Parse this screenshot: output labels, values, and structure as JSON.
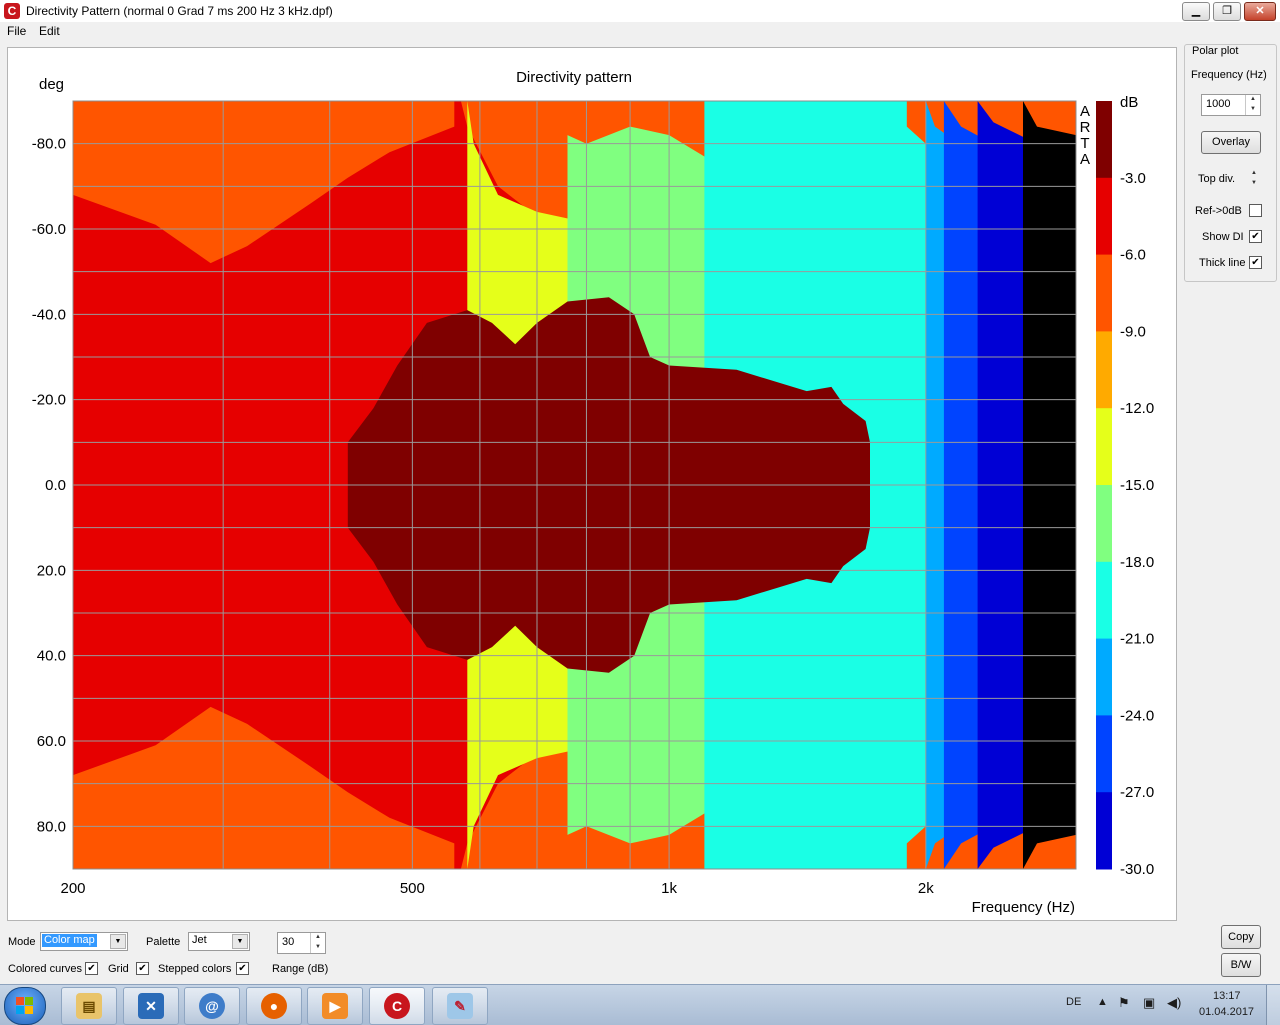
{
  "window": {
    "title": "Directivity Pattern  (normal 0 Grad 7 ms 200 Hz 3 kHz.dpf)",
    "app_icon_glyph": "C",
    "minimize_glyph": "▁",
    "restore_glyph": "❐",
    "close_glyph": "✕"
  },
  "menu": {
    "file": "File",
    "edit": "Edit"
  },
  "chart_data": {
    "type": "heatmap",
    "title": "Directivity pattern",
    "ylabel": "deg",
    "xlabel": "Frequency (Hz)",
    "x_scale": "log",
    "xlim": [
      200,
      3000
    ],
    "ylim": [
      -90,
      90
    ],
    "x_tick_labels": [
      {
        "value": 200,
        "label": "200"
      },
      {
        "value": 500,
        "label": "500"
      },
      {
        "value": 1000,
        "label": "1k"
      },
      {
        "value": 2000,
        "label": "2k"
      }
    ],
    "x_gridlines": [
      200,
      300,
      400,
      500,
      600,
      700,
      800,
      900,
      1000,
      2000,
      3000
    ],
    "y_ticks": [
      -80,
      -60,
      -40,
      -20,
      0,
      20,
      40,
      60,
      80
    ],
    "y_tick_labels": [
      "-80.0",
      "-60.0",
      "-40.0",
      "-20.0",
      "0.0",
      "20.0",
      "40.0",
      "60.0",
      "80.0"
    ],
    "y_gridlines": [
      -90,
      -80,
      -70,
      -60,
      -50,
      -40,
      -30,
      -20,
      -10,
      0,
      10,
      20,
      30,
      40,
      50,
      60,
      70,
      80,
      90
    ],
    "grid": true,
    "watermark": [
      "A",
      "R",
      "T",
      "A"
    ],
    "colorbar": {
      "unit": "dB",
      "tick_labels": [
        "-3.0",
        "-6.0",
        "-9.0",
        "-12.0",
        "-15.0",
        "-18.0",
        "-21.0",
        "-24.0",
        "-27.0",
        "-30.0"
      ],
      "levels": [
        {
          "max": 0,
          "min": -3,
          "color": "#7f0000"
        },
        {
          "max": -3,
          "min": -6,
          "color": "#e60000"
        },
        {
          "max": -6,
          "min": -9,
          "color": "#ff5500"
        },
        {
          "max": -9,
          "min": -12,
          "color": "#ffaa00"
        },
        {
          "max": -12,
          "min": -15,
          "color": "#e5ff1a"
        },
        {
          "max": -15,
          "min": -18,
          "color": "#80ff80"
        },
        {
          "max": -18,
          "min": -21,
          "color": "#1affe5"
        },
        {
          "max": -21,
          "min": -24,
          "color": "#00aaff"
        },
        {
          "max": -24,
          "min": -27,
          "color": "#0044ff"
        },
        {
          "max": -27,
          "min": -30,
          "color": "#0000d5"
        }
      ]
    },
    "contours": [
      {
        "level": -6,
        "points": [
          [
            200,
            -90
          ],
          [
            200,
            -68
          ],
          [
            250,
            -61
          ],
          [
            290,
            -52
          ],
          [
            320,
            -56
          ],
          [
            380,
            -66
          ],
          [
            420,
            -72
          ],
          [
            470,
            -78
          ],
          [
            560,
            -84
          ],
          [
            560,
            -90
          ],
          [
            570,
            -90
          ],
          [
            580,
            -84
          ],
          [
            630,
            -70
          ],
          [
            720,
            -61
          ],
          [
            800,
            -60
          ],
          [
            900,
            -64
          ],
          [
            960,
            -60
          ],
          [
            1050,
            -52
          ],
          [
            1200,
            -47
          ],
          [
            1400,
            -44
          ],
          [
            1600,
            -44
          ],
          [
            1900,
            -36
          ],
          [
            2200,
            -26
          ],
          [
            2400,
            -18
          ],
          [
            2500,
            -8
          ],
          [
            2500,
            8
          ],
          [
            2400,
            18
          ],
          [
            2200,
            26
          ],
          [
            1900,
            36
          ],
          [
            1600,
            44
          ],
          [
            1400,
            44
          ],
          [
            1200,
            47
          ],
          [
            1050,
            52
          ],
          [
            960,
            60
          ],
          [
            900,
            64
          ],
          [
            800,
            60
          ],
          [
            720,
            61
          ],
          [
            630,
            70
          ],
          [
            580,
            84
          ],
          [
            570,
            90
          ],
          [
            560,
            90
          ],
          [
            560,
            84
          ],
          [
            470,
            78
          ],
          [
            420,
            72
          ],
          [
            380,
            66
          ],
          [
            320,
            56
          ],
          [
            290,
            52
          ],
          [
            250,
            61
          ],
          [
            200,
            68
          ],
          [
            200,
            90
          ]
        ]
      },
      {
        "level": -9,
        "points": [
          [
            580,
            -90
          ],
          [
            590,
            -80
          ],
          [
            630,
            -68
          ],
          [
            700,
            -64
          ],
          [
            780,
            -62
          ],
          [
            860,
            -60
          ],
          [
            920,
            -70
          ],
          [
            1000,
            -70
          ],
          [
            1100,
            -64
          ],
          [
            1300,
            -63
          ],
          [
            1500,
            -62
          ],
          [
            1800,
            -58
          ],
          [
            2050,
            -50
          ],
          [
            2400,
            -40
          ],
          [
            2700,
            -34
          ],
          [
            3000,
            -26
          ],
          [
            3000,
            26
          ],
          [
            2700,
            34
          ],
          [
            2400,
            40
          ],
          [
            2050,
            50
          ],
          [
            1800,
            58
          ],
          [
            1500,
            62
          ],
          [
            1300,
            63
          ],
          [
            1100,
            64
          ],
          [
            1000,
            70
          ],
          [
            920,
            70
          ],
          [
            860,
            60
          ],
          [
            780,
            62
          ],
          [
            700,
            64
          ],
          [
            630,
            68
          ],
          [
            590,
            80
          ],
          [
            580,
            90
          ]
        ]
      },
      {
        "level": -12,
        "points": [
          [
            760,
            -90
          ],
          [
            760,
            -82
          ],
          [
            800,
            -80
          ],
          [
            900,
            -84
          ],
          [
            1000,
            -82
          ],
          [
            1100,
            -77
          ],
          [
            1400,
            -76
          ],
          [
            1700,
            -74
          ],
          [
            2000,
            -72
          ],
          [
            2200,
            -67
          ],
          [
            2600,
            -62
          ],
          [
            3000,
            -56
          ],
          [
            3000,
            56
          ],
          [
            2600,
            62
          ],
          [
            2200,
            67
          ],
          [
            2000,
            72
          ],
          [
            1700,
            74
          ],
          [
            1400,
            76
          ],
          [
            1100,
            77
          ],
          [
            1000,
            82
          ],
          [
            900,
            84
          ],
          [
            800,
            80
          ],
          [
            760,
            82
          ],
          [
            760,
            90
          ]
        ]
      },
      {
        "level": -15,
        "points": [
          [
            1100,
            -90
          ],
          [
            1100,
            -90
          ],
          [
            1900,
            -90
          ],
          [
            1900,
            -84
          ],
          [
            2000,
            -80
          ],
          [
            2200,
            -75
          ],
          [
            2600,
            -70
          ],
          [
            3000,
            -67
          ],
          [
            3000,
            67
          ],
          [
            2600,
            70
          ],
          [
            2200,
            75
          ],
          [
            2000,
            80
          ],
          [
            1900,
            84
          ],
          [
            1900,
            90
          ],
          [
            1100,
            90
          ]
        ]
      },
      {
        "level": -18,
        "points": [
          [
            2000,
            -90
          ],
          [
            2050,
            -84
          ],
          [
            2300,
            -77
          ],
          [
            2700,
            -72
          ],
          [
            3000,
            -70
          ],
          [
            3000,
            70
          ],
          [
            2700,
            72
          ],
          [
            2300,
            77
          ],
          [
            2050,
            84
          ],
          [
            2000,
            90
          ]
        ]
      },
      {
        "level": -21,
        "points": [
          [
            2100,
            -90
          ],
          [
            2200,
            -84
          ],
          [
            2500,
            -78
          ],
          [
            3000,
            -74
          ],
          [
            3000,
            74
          ],
          [
            2500,
            78
          ],
          [
            2200,
            84
          ],
          [
            2100,
            90
          ]
        ]
      },
      {
        "level": -24,
        "points": [
          [
            2300,
            -90
          ],
          [
            2400,
            -85
          ],
          [
            2700,
            -80
          ],
          [
            3000,
            -78
          ],
          [
            3000,
            78
          ],
          [
            2700,
            80
          ],
          [
            2400,
            85
          ],
          [
            2300,
            90
          ]
        ]
      },
      {
        "level": -27,
        "points": [
          [
            2600,
            -90
          ],
          [
            2700,
            -84
          ],
          [
            3000,
            -82
          ],
          [
            3000,
            82
          ],
          [
            2700,
            84
          ],
          [
            2600,
            90
          ]
        ]
      },
      {
        "level": -3,
        "points": [
          [
            420,
            -10
          ],
          [
            450,
            -18
          ],
          [
            480,
            -28
          ],
          [
            520,
            -38
          ],
          [
            580,
            -41
          ],
          [
            620,
            -38
          ],
          [
            660,
            -33
          ],
          [
            700,
            -38
          ],
          [
            760,
            -43
          ],
          [
            850,
            -44
          ],
          [
            910,
            -40
          ],
          [
            950,
            -30
          ],
          [
            1000,
            -28
          ],
          [
            1200,
            -27
          ],
          [
            1450,
            -22
          ],
          [
            1550,
            -23
          ],
          [
            1600,
            -19
          ],
          [
            1700,
            -15
          ],
          [
            1720,
            -10
          ],
          [
            1720,
            10
          ],
          [
            1700,
            15
          ],
          [
            1600,
            19
          ],
          [
            1550,
            23
          ],
          [
            1450,
            22
          ],
          [
            1200,
            27
          ],
          [
            1000,
            28
          ],
          [
            950,
            30
          ],
          [
            910,
            40
          ],
          [
            850,
            44
          ],
          [
            760,
            43
          ],
          [
            700,
            38
          ],
          [
            660,
            33
          ],
          [
            620,
            38
          ],
          [
            580,
            41
          ],
          [
            520,
            38
          ],
          [
            480,
            28
          ],
          [
            450,
            18
          ],
          [
            420,
            10
          ]
        ]
      }
    ]
  },
  "panel": {
    "group_title": "Polar plot",
    "frequency_label": "Frequency (Hz)",
    "frequency_value": "1000",
    "overlay_button": "Overlay",
    "topdiv_label": "Top div.",
    "ref0db_label": "Ref->0dB",
    "ref0db_checked": false,
    "showdi_label": "Show DI",
    "showdi_checked": true,
    "thickline_label": "Thick line",
    "thickline_checked": true
  },
  "bottom": {
    "mode_label": "Mode",
    "mode_value": "Color map",
    "palette_label": "Palette",
    "palette_value": "Jet",
    "range_value": "30",
    "range_label": "Range (dB)",
    "colored_curves_label": "Colored curves",
    "colored_curves_checked": true,
    "grid_label": "Grid",
    "grid_checked": true,
    "stepped_colors_label": "Stepped colors",
    "stepped_colors_checked": true,
    "copy_button": "Copy",
    "bw_button": "B/W"
  },
  "taskbar": {
    "apps": [
      "explorer-icon",
      "network-app-icon",
      "email-icon",
      "firefox-icon",
      "media-player-icon",
      "arta-icon",
      "paint-icon"
    ],
    "language": "DE",
    "time": "13:17",
    "date": "01.04.2017"
  }
}
